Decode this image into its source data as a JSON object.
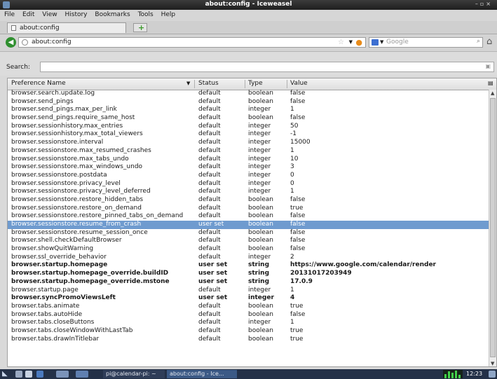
{
  "window": {
    "title": "about:config - Iceweasel"
  },
  "menu": [
    "File",
    "Edit",
    "View",
    "History",
    "Bookmarks",
    "Tools",
    "Help"
  ],
  "tab": {
    "label": "about:config"
  },
  "url": {
    "value": "about:config"
  },
  "search_engine": {
    "placeholder": "Google"
  },
  "filter": {
    "label": "Search:",
    "value": ""
  },
  "columns": {
    "name": "Preference Name",
    "status": "Status",
    "type": "Type",
    "value": "Value"
  },
  "rows": [
    [
      "browser.search.update.log",
      "default",
      "boolean",
      "false"
    ],
    [
      "browser.send_pings",
      "default",
      "boolean",
      "false"
    ],
    [
      "browser.send_pings.max_per_link",
      "default",
      "integer",
      "1"
    ],
    [
      "browser.send_pings.require_same_host",
      "default",
      "boolean",
      "false"
    ],
    [
      "browser.sessionhistory.max_entries",
      "default",
      "integer",
      "50"
    ],
    [
      "browser.sessionhistory.max_total_viewers",
      "default",
      "integer",
      "-1"
    ],
    [
      "browser.sessionstore.interval",
      "default",
      "integer",
      "15000"
    ],
    [
      "browser.sessionstore.max_resumed_crashes",
      "default",
      "integer",
      "1"
    ],
    [
      "browser.sessionstore.max_tabs_undo",
      "default",
      "integer",
      "10"
    ],
    [
      "browser.sessionstore.max_windows_undo",
      "default",
      "integer",
      "3"
    ],
    [
      "browser.sessionstore.postdata",
      "default",
      "integer",
      "0"
    ],
    [
      "browser.sessionstore.privacy_level",
      "default",
      "integer",
      "0"
    ],
    [
      "browser.sessionstore.privacy_level_deferred",
      "default",
      "integer",
      "1"
    ],
    [
      "browser.sessionstore.restore_hidden_tabs",
      "default",
      "boolean",
      "false"
    ],
    [
      "browser.sessionstore.restore_on_demand",
      "default",
      "boolean",
      "true"
    ],
    [
      "browser.sessionstore.restore_pinned_tabs_on_demand",
      "default",
      "boolean",
      "false"
    ],
    [
      "browser.sessionstore.resume_from_crash",
      "user set",
      "boolean",
      "false"
    ],
    [
      "browser.sessionstore.resume_session_once",
      "default",
      "boolean",
      "false"
    ],
    [
      "browser.shell.checkDefaultBrowser",
      "default",
      "boolean",
      "false"
    ],
    [
      "browser.showQuitWarning",
      "default",
      "boolean",
      "false"
    ],
    [
      "browser.ssl_override_behavior",
      "default",
      "integer",
      "2"
    ],
    [
      "browser.startup.homepage",
      "user set",
      "string",
      "https://www.google.com/calendar/render"
    ],
    [
      "browser.startup.homepage_override.buildID",
      "user set",
      "string",
      "20131017203949"
    ],
    [
      "browser.startup.homepage_override.mstone",
      "user set",
      "string",
      "17.0.9"
    ],
    [
      "browser.startup.page",
      "default",
      "integer",
      "1"
    ],
    [
      "browser.syncPromoViewsLeft",
      "user set",
      "integer",
      "4"
    ],
    [
      "browser.tabs.animate",
      "default",
      "boolean",
      "true"
    ],
    [
      "browser.tabs.autoHide",
      "default",
      "boolean",
      "false"
    ],
    [
      "browser.tabs.closeButtons",
      "default",
      "integer",
      "1"
    ],
    [
      "browser.tabs.closeWindowWithLastTab",
      "default",
      "boolean",
      "true"
    ],
    [
      "browser.tabs.drawInTitlebar",
      "default",
      "boolean",
      "true"
    ]
  ],
  "selected_row": 16,
  "taskbar": {
    "tasks": [
      "pi@calendar-pi: ~",
      "about:config - Ice..."
    ],
    "clock": "12:23"
  },
  "colors": {
    "selection": "#6f9bcf",
    "titlebar": "#2b2b2b",
    "taskbar": "#243148"
  }
}
